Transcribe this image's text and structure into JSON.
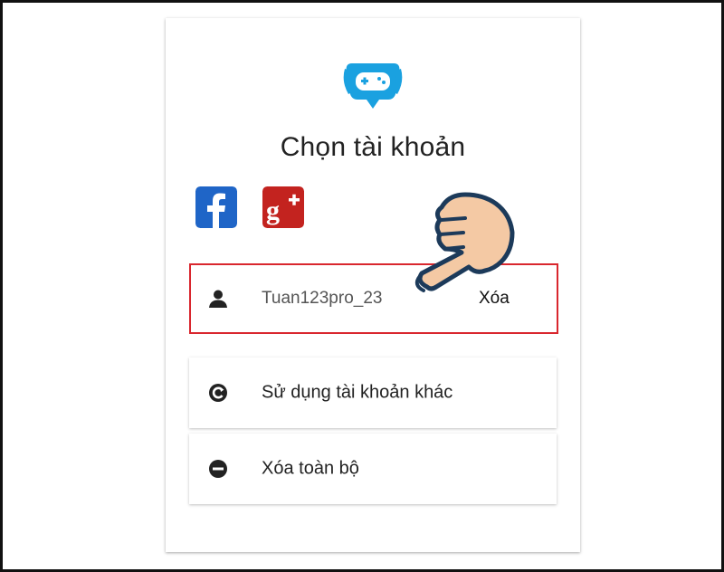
{
  "dialog": {
    "title": "Chọn tài khoản"
  },
  "icons": {
    "logo": "gamepad-speech-bubble-logo",
    "facebook": "facebook-icon",
    "google_plus": "google-plus-icon",
    "account": "user-icon",
    "other_account": "refresh-icon",
    "clear_all": "minus-circle-icon",
    "hand_pointer": "pointing-hand-icon"
  },
  "accounts": [
    {
      "username": "Tuan123pro_23",
      "remove_label": "Xóa"
    }
  ],
  "actions": {
    "use_other_account": "Sử dụng tài khoản khác",
    "clear_all": "Xóa toàn bộ"
  },
  "colors": {
    "highlight": "#d9272e",
    "facebook": "#1f65c7",
    "google_plus": "#c3231f",
    "logo": "#1aa1e0",
    "hand_fill": "#f4c9a4",
    "hand_outline": "#1c3a5a"
  }
}
